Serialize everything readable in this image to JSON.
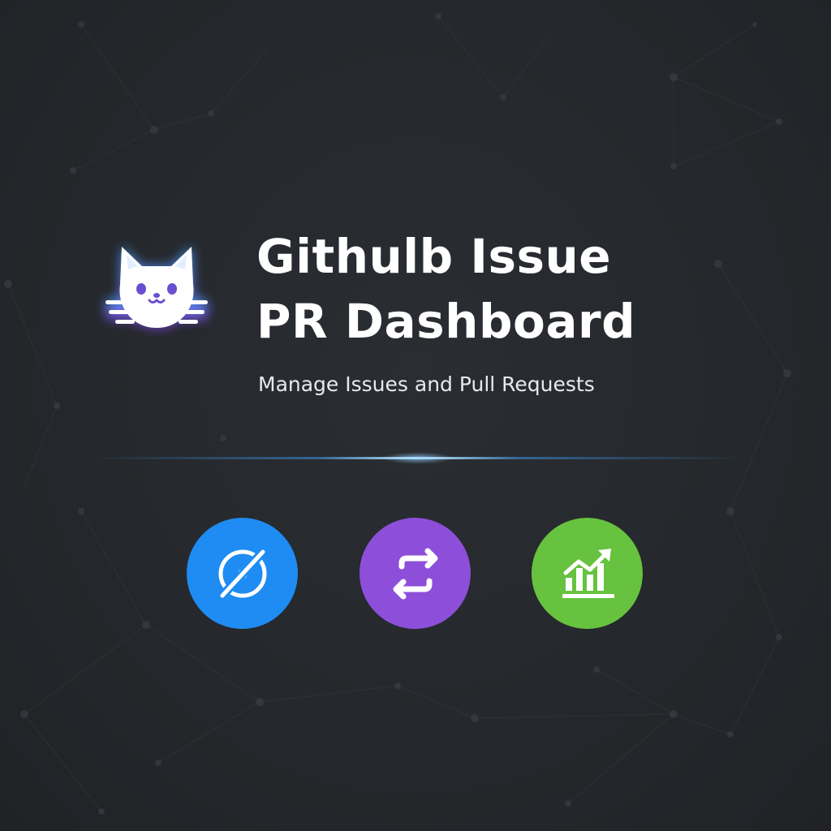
{
  "app": {
    "title_line1": "Githulb Issue",
    "title_line2": "PR Dashboard",
    "subtitle": "Manage Issues and Pull Requests"
  },
  "logo": {
    "icon": "cat-icon",
    "glow_colors": [
      "#3fa9ff",
      "#8b3ff0"
    ]
  },
  "features": [
    {
      "icon": "issue-slash-icon",
      "color": "#1e8cf2"
    },
    {
      "icon": "pull-request-arrows-icon",
      "color": "#8d4fd9"
    },
    {
      "icon": "growth-chart-icon",
      "color": "#67c23f"
    }
  ],
  "theme": {
    "background": "#26292d",
    "text": "#ffffff",
    "accent_line": "#4aa8f0"
  }
}
